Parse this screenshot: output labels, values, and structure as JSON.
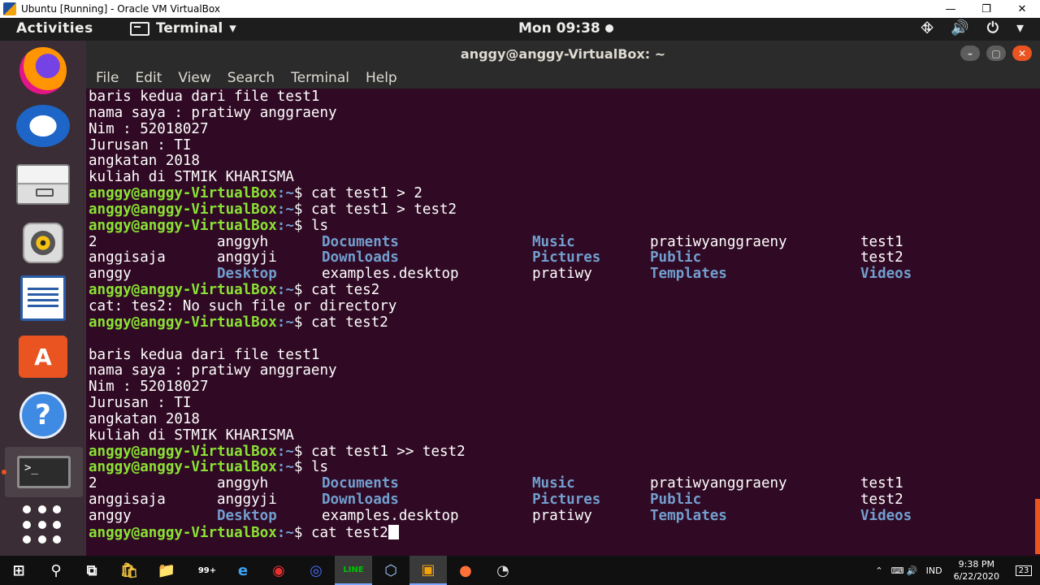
{
  "host_window": {
    "title": "Ubuntu [Running] - Oracle VM VirtualBox",
    "minimize": "—",
    "restore": "❐",
    "close": "✕"
  },
  "gnome_bar": {
    "activities": "Activities",
    "app_menu": "Terminal",
    "app_menu_arrow": "▾",
    "clock": "Mon 09:38",
    "tray": {
      "network": "⛗",
      "volume": "🔊",
      "power": "⏻",
      "menu_arrow": "▾"
    }
  },
  "dock": {
    "items": [
      {
        "name": "Firefox"
      },
      {
        "name": "Thunderbird Mail"
      },
      {
        "name": "Files"
      },
      {
        "name": "Rhythmbox"
      },
      {
        "name": "LibreOffice Writer"
      },
      {
        "name": "Ubuntu Software",
        "glyph": "A"
      },
      {
        "name": "Help",
        "glyph": "?"
      },
      {
        "name": "Terminal",
        "glyph": ">_"
      },
      {
        "name": "Show Applications"
      }
    ]
  },
  "terminal": {
    "window_title": "anggy@anggy-VirtualBox: ~",
    "window_buttons": {
      "minimize": "–",
      "maximize": "▢",
      "close": "✕"
    },
    "menu": [
      "File",
      "Edit",
      "View",
      "Search",
      "Terminal",
      "Help"
    ],
    "prompt_user": "anggy@anggy-VirtualBox",
    "prompt_path": ":~",
    "prompt_symbol": "$ ",
    "lines": [
      {
        "type": "text",
        "text": "baris kedua dari file test1"
      },
      {
        "type": "text",
        "text": "nama saya : pratiwy anggraeny"
      },
      {
        "type": "text",
        "text": "Nim : 52018027"
      },
      {
        "type": "text",
        "text": "Jurusan : TI"
      },
      {
        "type": "text",
        "text": "angkatan 2018"
      },
      {
        "type": "text",
        "text": "kuliah di STMIK KHARISMA"
      },
      {
        "type": "prompt",
        "cmd": "cat test1 > 2"
      },
      {
        "type": "prompt",
        "cmd": "cat test1 > test2"
      },
      {
        "type": "prompt",
        "cmd": "ls"
      },
      {
        "type": "ls",
        "cells": [
          {
            "t": "2",
            "d": false
          },
          {
            "t": "anggyh",
            "d": false
          },
          {
            "t": "Documents",
            "d": true
          },
          {
            "t": "Music",
            "d": true
          },
          {
            "t": "pratiwyanggraeny",
            "d": false
          },
          {
            "t": "test1",
            "d": false
          }
        ]
      },
      {
        "type": "ls",
        "cells": [
          {
            "t": "anggisaja",
            "d": false
          },
          {
            "t": "anggyji",
            "d": false
          },
          {
            "t": "Downloads",
            "d": true
          },
          {
            "t": "Pictures",
            "d": true
          },
          {
            "t": "Public",
            "d": true
          },
          {
            "t": "test2",
            "d": false
          }
        ]
      },
      {
        "type": "ls",
        "cells": [
          {
            "t": "anggy",
            "d": false
          },
          {
            "t": "Desktop",
            "d": true
          },
          {
            "t": "examples.desktop",
            "d": false
          },
          {
            "t": "pratiwy",
            "d": false
          },
          {
            "t": "Templates",
            "d": true
          },
          {
            "t": "Videos",
            "d": true
          }
        ]
      },
      {
        "type": "prompt",
        "cmd": "cat tes2"
      },
      {
        "type": "text",
        "text": "cat: tes2: No such file or directory"
      },
      {
        "type": "prompt",
        "cmd": "cat test2"
      },
      {
        "type": "text",
        "text": ""
      },
      {
        "type": "text",
        "text": "baris kedua dari file test1"
      },
      {
        "type": "text",
        "text": "nama saya : pratiwy anggraeny"
      },
      {
        "type": "text",
        "text": "Nim : 52018027"
      },
      {
        "type": "text",
        "text": "Jurusan : TI"
      },
      {
        "type": "text",
        "text": "angkatan 2018"
      },
      {
        "type": "text",
        "text": "kuliah di STMIK KHARISMA"
      },
      {
        "type": "prompt",
        "cmd": "cat test1 >> test2"
      },
      {
        "type": "prompt",
        "cmd": "ls"
      },
      {
        "type": "ls",
        "cells": [
          {
            "t": "2",
            "d": false
          },
          {
            "t": "anggyh",
            "d": false
          },
          {
            "t": "Documents",
            "d": true
          },
          {
            "t": "Music",
            "d": true
          },
          {
            "t": "pratiwyanggraeny",
            "d": false
          },
          {
            "t": "test1",
            "d": false
          }
        ]
      },
      {
        "type": "ls",
        "cells": [
          {
            "t": "anggisaja",
            "d": false
          },
          {
            "t": "anggyji",
            "d": false
          },
          {
            "t": "Downloads",
            "d": true
          },
          {
            "t": "Pictures",
            "d": true
          },
          {
            "t": "Public",
            "d": true
          },
          {
            "t": "test2",
            "d": false
          }
        ]
      },
      {
        "type": "ls",
        "cells": [
          {
            "t": "anggy",
            "d": false
          },
          {
            "t": "Desktop",
            "d": true
          },
          {
            "t": "examples.desktop",
            "d": false
          },
          {
            "t": "pratiwy",
            "d": false
          },
          {
            "t": "Templates",
            "d": true
          },
          {
            "t": "Videos",
            "d": true
          }
        ]
      },
      {
        "type": "prompt",
        "cmd": "cat test2",
        "cursor": true
      }
    ]
  },
  "taskbar": {
    "items": [
      {
        "name": "windows-start",
        "glyph": "⊞"
      },
      {
        "name": "search",
        "glyph": "⚲"
      },
      {
        "name": "task-view",
        "glyph": "⧉"
      },
      {
        "name": "microsoft-store",
        "glyph": "🛍"
      },
      {
        "name": "file-explorer",
        "glyph": "📁"
      },
      {
        "name": "mail-badge",
        "glyph": "99+"
      },
      {
        "name": "edge",
        "glyph": "e"
      },
      {
        "name": "app-red",
        "glyph": "◉"
      },
      {
        "name": "app-blue",
        "glyph": "◎"
      },
      {
        "name": "line",
        "glyph": "LINE"
      },
      {
        "name": "virtualbox-cube",
        "glyph": "⬡"
      },
      {
        "name": "virtualbox",
        "glyph": "▣"
      },
      {
        "name": "firefox",
        "glyph": "●"
      },
      {
        "name": "obs",
        "glyph": "◔"
      }
    ],
    "tray_chevron": "⌃",
    "tray_icons": "⌨ 🔊",
    "language": "IND",
    "time": "9:38 PM",
    "date": "6/22/2020",
    "notification_count": "23"
  }
}
